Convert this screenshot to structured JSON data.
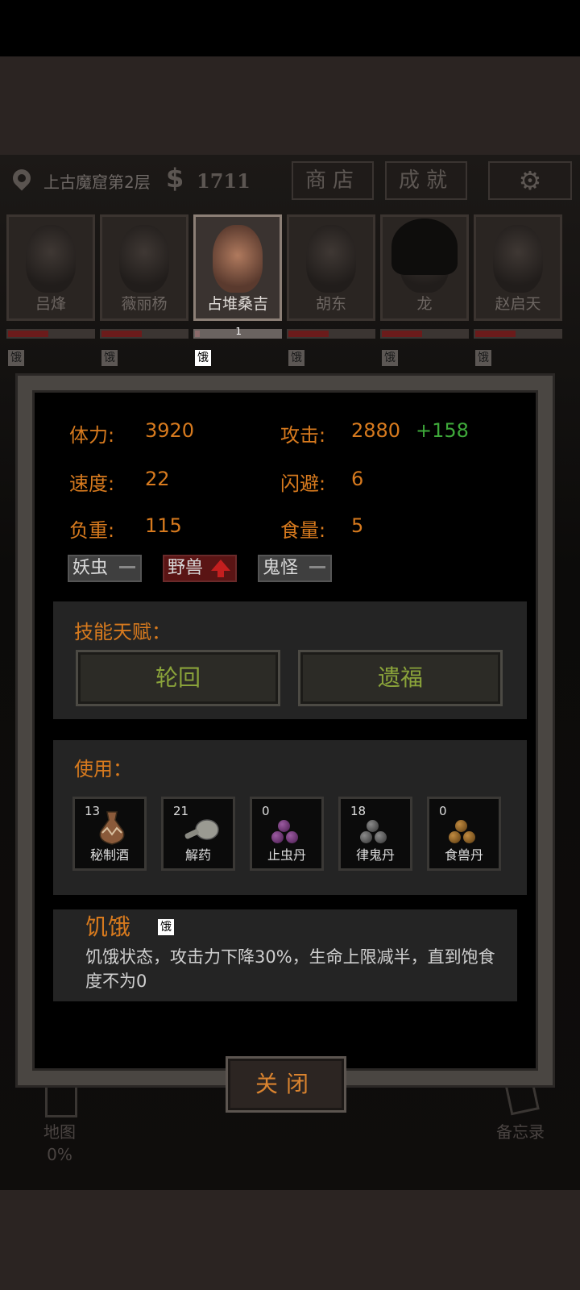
{
  "header": {
    "location": "上古魔窟第2层",
    "currency_symbol": "$",
    "money": "1711",
    "shop_label": "商店",
    "achievements_label": "成就"
  },
  "party": [
    {
      "name": "吕烽",
      "hunger": "饿"
    },
    {
      "name": "薇丽杨",
      "hunger": "饿"
    },
    {
      "name": "占堆桑吉",
      "hunger": "饿",
      "level": "1"
    },
    {
      "name": "胡东",
      "hunger": "饿"
    },
    {
      "name": "龙",
      "hunger": "饿"
    },
    {
      "name": "赵启天",
      "hunger": "饿"
    }
  ],
  "stats": {
    "stamina_label": "体力:",
    "stamina": "3920",
    "attack_label": "攻击:",
    "attack": "2880",
    "attack_bonus": "+158",
    "speed_label": "速度:",
    "speed": "22",
    "dodge_label": "闪避:",
    "dodge": "6",
    "load_label": "负重:",
    "load": "115",
    "food_label": "食量:",
    "food": "5"
  },
  "resistances": [
    {
      "label": "妖虫"
    },
    {
      "label": "野兽"
    },
    {
      "label": "鬼怪"
    }
  ],
  "skills": {
    "title": "技能天赋：",
    "items": [
      "轮回",
      "遗福"
    ]
  },
  "use": {
    "title": "使用：",
    "items": [
      {
        "count": "13",
        "name": "秘制酒"
      },
      {
        "count": "21",
        "name": "解药"
      },
      {
        "count": "0",
        "name": "止虫丹"
      },
      {
        "count": "18",
        "name": "律鬼丹"
      },
      {
        "count": "0",
        "name": "食兽丹"
      }
    ]
  },
  "status": {
    "title": "饥饿",
    "icon_text": "饿",
    "description": "饥饿状态，攻击力下降30%，生命上限减半，直到饱食度不为0"
  },
  "close_label": "关闭",
  "background": {
    "map_label": "地图",
    "map_progress": "0%",
    "memo_label": "备忘录"
  },
  "colors": {
    "accent": "#d77a1e",
    "bonus": "#3ea93a",
    "skill_text": "#8aa33a"
  }
}
